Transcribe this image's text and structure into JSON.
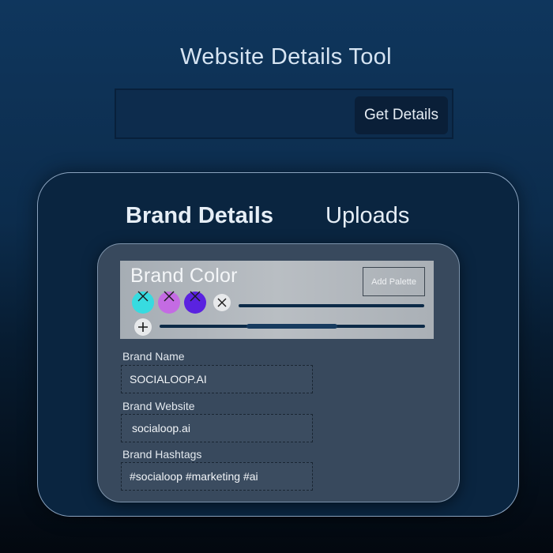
{
  "app": {
    "title": "Website Details Tool"
  },
  "url_bar": {
    "value": "",
    "button_label": "Get Details"
  },
  "tabs": [
    {
      "label": "Brand Details",
      "active": true
    },
    {
      "label": "Uploads",
      "active": false
    }
  ],
  "brand_color": {
    "title": "Brand Color",
    "add_palette_label": "Add Palette",
    "swatches": [
      {
        "color": "#37dbe0",
        "icon": "close-icon"
      },
      {
        "color": "#c46be3",
        "icon": "close-icon"
      },
      {
        "color": "#5a22e0",
        "icon": "close-icon"
      }
    ],
    "remove_icon": "close-icon",
    "add_icon": "plus-icon"
  },
  "fields": {
    "brand_name": {
      "label": "Brand Name",
      "value": "SOCIALOOP.AI"
    },
    "brand_website": {
      "label": "Brand Website",
      "value": "socialoop.ai"
    },
    "brand_hashtags": {
      "label": "Brand Hashtags",
      "value": "#socialoop #marketing #ai"
    }
  },
  "colors": {
    "background_top": "#0f365d",
    "background_bottom": "#03080f",
    "card": "#0a2540",
    "inner_card": "#38495d",
    "button": "#0a1f38"
  }
}
